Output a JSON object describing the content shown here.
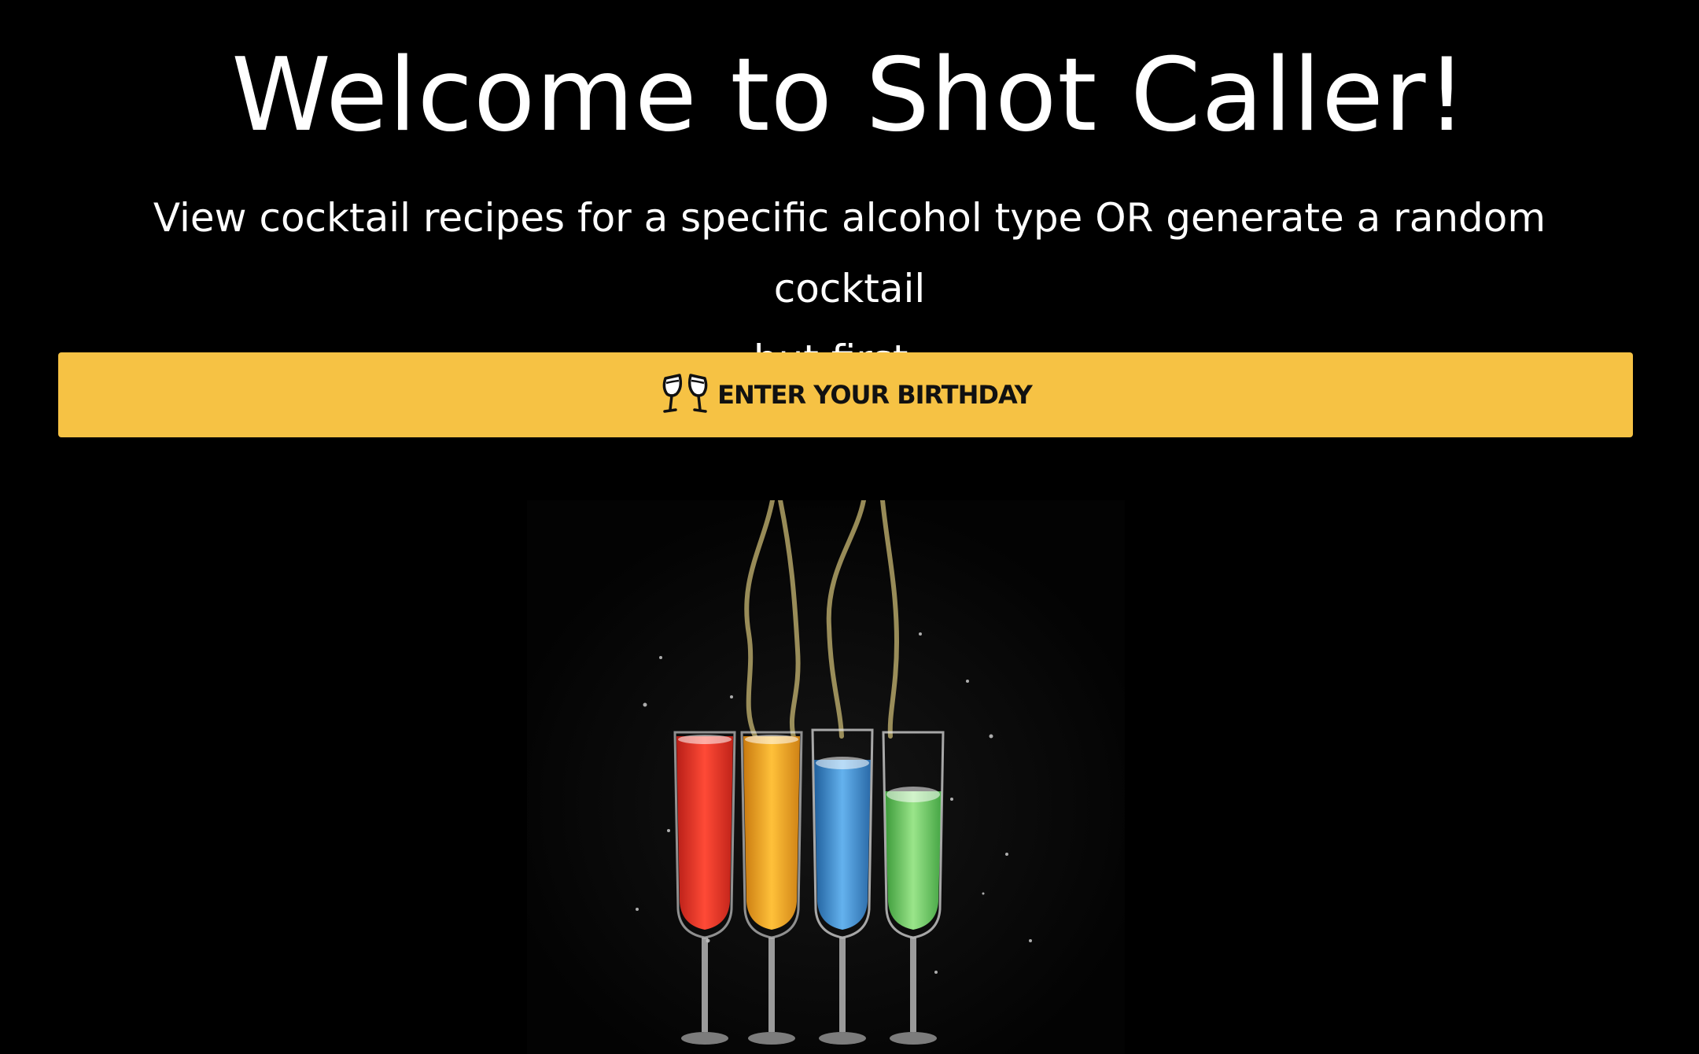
{
  "header": {
    "title": "Welcome to Shot Caller!",
    "subtitle_line1": "View cocktail recipes for a specific alcohol type OR generate a random cocktail",
    "subtitle_line2": "but first..."
  },
  "birthday_button": {
    "label": "ENTER YOUR BIRTHDAY",
    "icon": "clinking-glasses-icon"
  },
  "hero_image": {
    "subject": "four champagne flutes with splashing drinks",
    "glass_colors": [
      "#e83a2c",
      "#f2a52a",
      "#3c8fd1",
      "#6cc163"
    ]
  },
  "colors": {
    "background": "#000000",
    "text": "#ffffff",
    "button": "#f6c244",
    "button_text": "#111111"
  }
}
